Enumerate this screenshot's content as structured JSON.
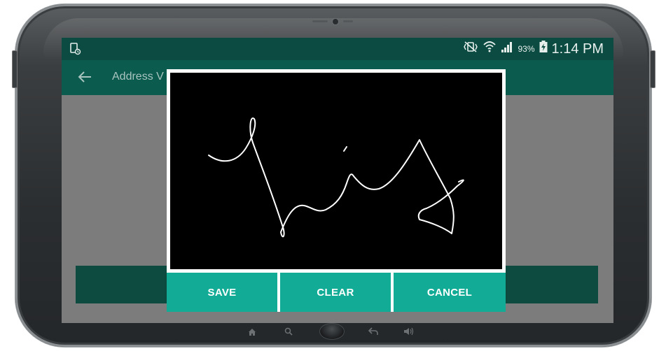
{
  "status_bar": {
    "battery_percent": "93%",
    "time": "1:14 PM"
  },
  "app_bar": {
    "title": "Address V"
  },
  "signature_dialog": {
    "save_label": "SAVE",
    "clear_label": "CLEAR",
    "cancel_label": "CANCEL"
  },
  "colors": {
    "status_bar": "#0b4b41",
    "app_bar": "#0b5b4f",
    "button": "#12ab96",
    "canvas": "#000000"
  }
}
